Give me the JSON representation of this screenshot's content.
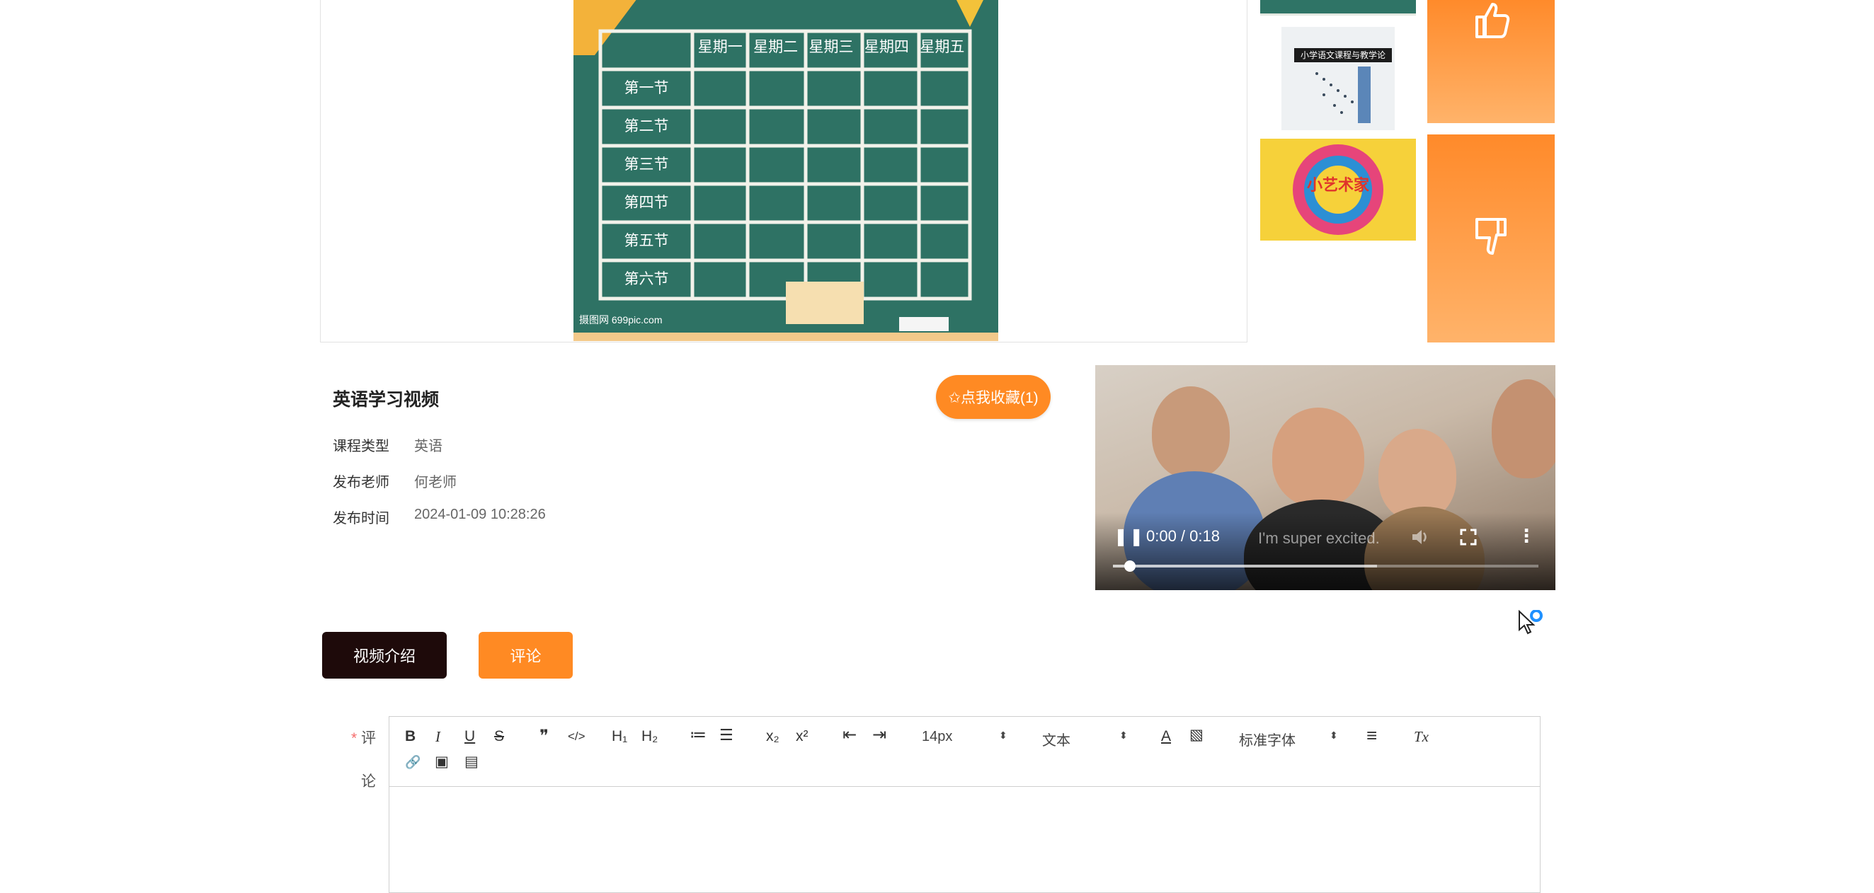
{
  "course": {
    "title": "英语学习视频",
    "favorite_label": "✩点我收藏(1)",
    "type_label": "课程类型",
    "type_value": "英语",
    "teacher_label": "发布老师",
    "teacher_value": "何老师",
    "time_label": "发布时间",
    "time_value": "2024-01-09 10:28:26"
  },
  "schedule_image": {
    "weekdays": [
      "星期一",
      "星期二",
      "星期三",
      "星期四",
      "星期五"
    ],
    "periods": [
      "第一节",
      "第二节",
      "第三节",
      "第四节",
      "第五节",
      "第六节"
    ],
    "watermark": "摄图网 699pic.com"
  },
  "thumbnails": {
    "book_title": "小学语文课程与教学论",
    "poster_title": "小艺术家"
  },
  "vote": {
    "up_icon": "thumbs-up-icon",
    "down_icon": "thumbs-down-icon"
  },
  "video": {
    "time": "0:00 / 0:18",
    "caption": "I'm super excited.",
    "progress": 0.04,
    "buffered": 0.62
  },
  "tabs": {
    "intro": "视频介绍",
    "comment": "评论"
  },
  "editor": {
    "label_star": "*",
    "label_line1": "评",
    "label_line2": "论",
    "font_size": "14px",
    "block_type": "文本",
    "font_family": "标准字体",
    "tools": {
      "bold": "B",
      "italic": "I",
      "underline": "U",
      "strike": "S",
      "quote": "❞",
      "code": "</>",
      "h1": "H₁",
      "h2": "H₂",
      "ordered": "≔",
      "bullet": "☰",
      "sub": "x₂",
      "sup": "x²",
      "outdent": "⇤",
      "indent": "⇥",
      "color": "A",
      "bg": "▧",
      "align": "≡",
      "clear": "Tx",
      "link": "🔗",
      "image": "▣",
      "video": "▤"
    }
  }
}
